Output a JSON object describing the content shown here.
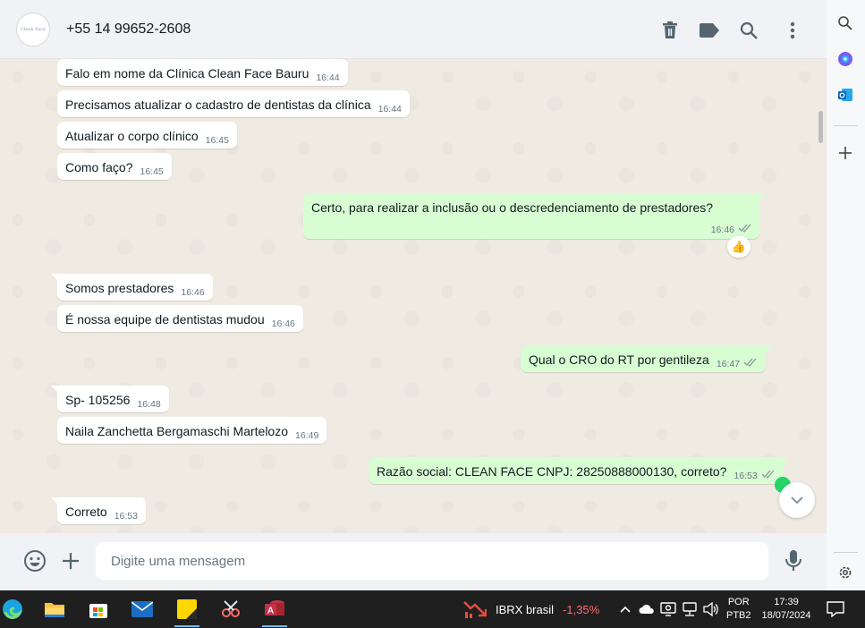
{
  "contact": {
    "name": "+55 14 99652-2608",
    "avatar_text": "Clean Face"
  },
  "messages": [
    {
      "dir": "in",
      "text": "Falo em nome da Clínica Clean Face Bauru",
      "time": "16:44"
    },
    {
      "dir": "in",
      "text": "Precisamos atualizar o cadastro de dentistas da clínica",
      "time": "16:44"
    },
    {
      "dir": "in",
      "text": "Atualizar o corpo clínico",
      "time": "16:45"
    },
    {
      "dir": "in",
      "text": "Como faço?",
      "time": "16:45"
    },
    {
      "dir": "out",
      "text": "Certo, para realizar a inclusão ou o descredenciamento de prestadores?",
      "time": "16:46"
    },
    {
      "dir": "in",
      "text": "Somos prestadores",
      "time": "16:46"
    },
    {
      "dir": "in",
      "text": "É nossa equipe de dentistas mudou",
      "time": "16:46"
    },
    {
      "dir": "out",
      "text": "Qual o CRO do RT por gentileza",
      "time": "16:47"
    },
    {
      "dir": "in",
      "text": "Sp- 105256",
      "time": "16:48"
    },
    {
      "dir": "in",
      "text": "Naila Zanchetta Bergamaschi Martelozo",
      "time": "16:49"
    },
    {
      "dir": "out",
      "text": "Razão social: CLEAN FACE CNPJ: 28250888000130, correto?",
      "time": "16:53"
    },
    {
      "dir": "in",
      "text": "Correto",
      "time": "16:53"
    }
  ],
  "reaction": "👍",
  "composer": {
    "placeholder": "Digite uma mensagem"
  },
  "taskbar": {
    "ibrx_name": "IBRX brasil",
    "ibrx_change": "-1,35%",
    "lang_line1": "POR",
    "lang_line2": "PTB2",
    "time": "17:39",
    "date": "18/07/2024"
  },
  "colors": {
    "outgoing_bubble": "#d9fdd3",
    "incoming_bubble": "#ffffff",
    "unread_dot": "#25d366",
    "negative_change": "#ff6b6b"
  }
}
